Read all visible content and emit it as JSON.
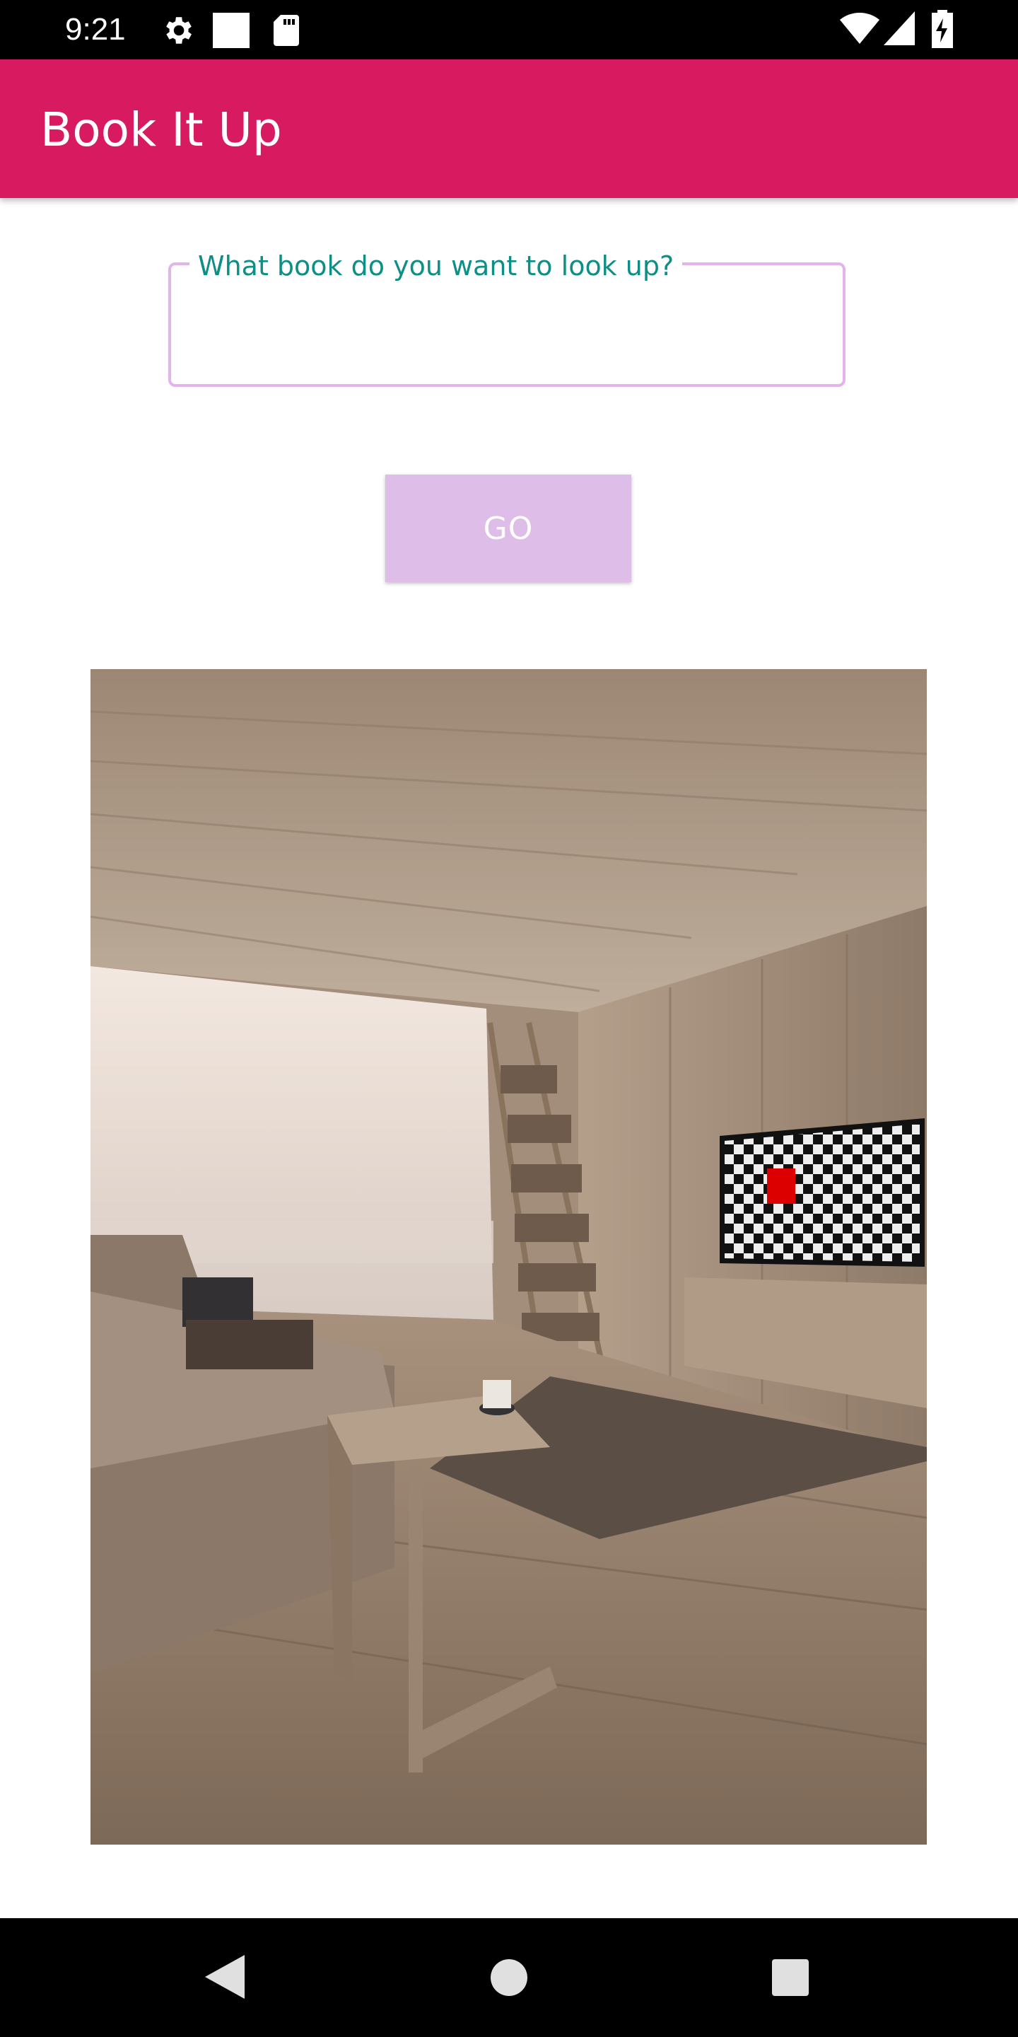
{
  "status_bar": {
    "time": "9:21",
    "icons_left": [
      "gear-icon",
      "square-icon",
      "sd-card-icon"
    ],
    "icons_right": [
      "wifi-icon",
      "signal-icon",
      "battery-charging-icon"
    ]
  },
  "app_bar": {
    "title": "Book It Up",
    "color": "#d81b60"
  },
  "search": {
    "label": "What book do you want to look up?",
    "value": "",
    "border_color": "#e3b3ec",
    "label_color": "#0e8f86"
  },
  "go_button": {
    "label": "GO",
    "color": "#dfbde9"
  },
  "nav_bar": {
    "icons": [
      "back-icon",
      "home-icon",
      "recents-icon"
    ]
  }
}
